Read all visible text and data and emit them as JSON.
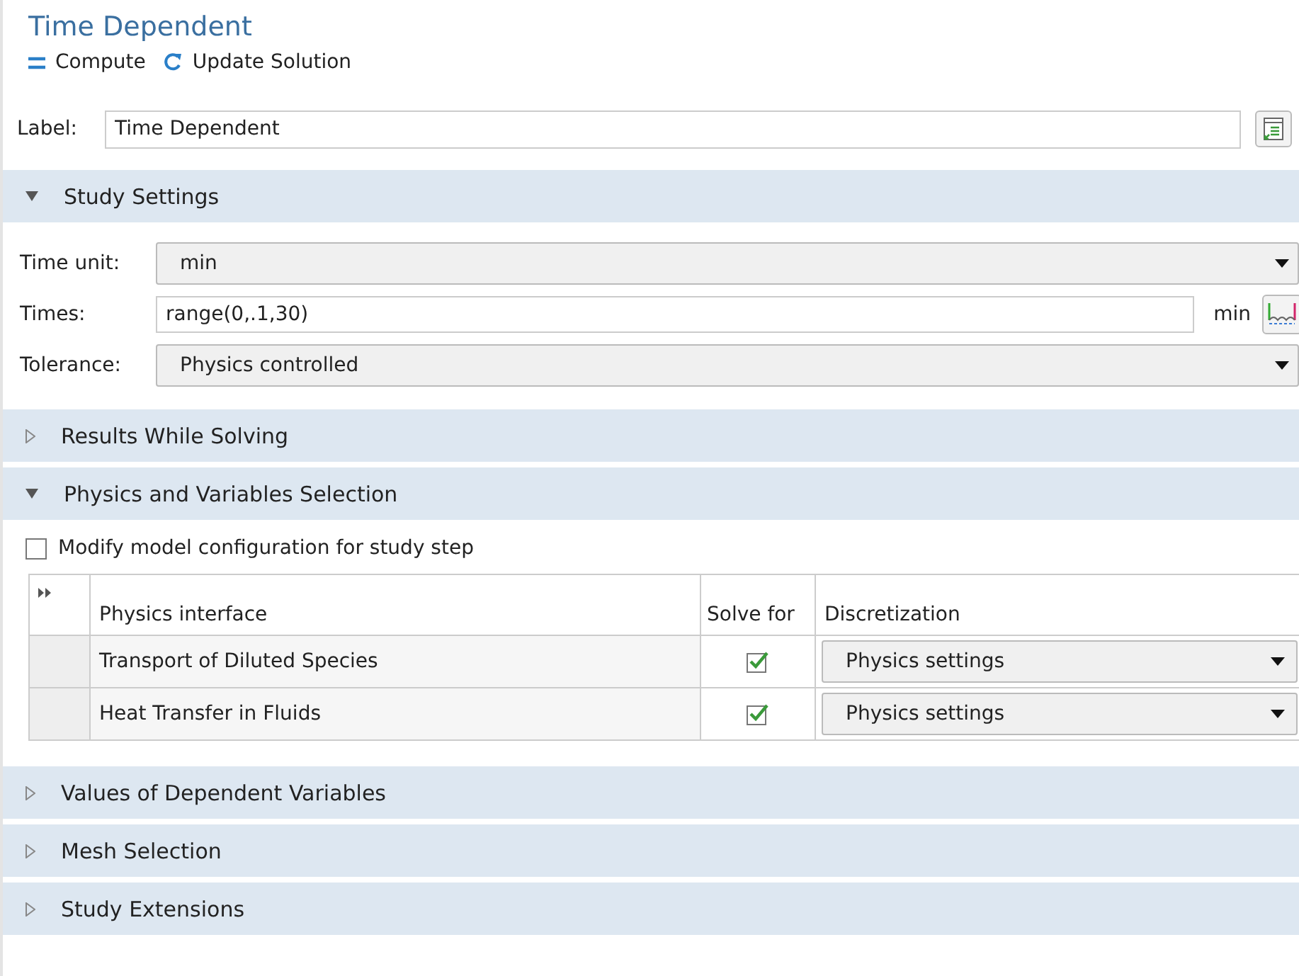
{
  "title": "Time Dependent",
  "toolbar": [
    {
      "kind": "compute",
      "label": "Compute"
    },
    {
      "kind": "update",
      "label": "Update Solution"
    }
  ],
  "label_field": {
    "label": "Label:",
    "value": "Time Dependent"
  },
  "sections": [
    {
      "title": "Study Settings",
      "expanded": true,
      "kind": "study",
      "fields": [
        {
          "kind": "select",
          "label": "Time unit:",
          "value": "min"
        },
        {
          "kind": "text",
          "label": "Times:",
          "value": "range(0,.1,30)",
          "unit": "min"
        },
        {
          "kind": "select",
          "label": "Tolerance:",
          "value": "Physics controlled"
        }
      ]
    },
    {
      "title": "Results While Solving",
      "expanded": false
    },
    {
      "title": "Physics and Variables Selection",
      "expanded": true,
      "kind": "physics",
      "checkbox": {
        "label": "Modify model configuration for study step",
        "checked": false
      },
      "table": {
        "columns": [
          "Physics interface",
          "Solve for",
          "Discretization"
        ],
        "rows": [
          {
            "interface": "Transport of Diluted Species",
            "solve_for": true,
            "discretization": "Physics settings"
          },
          {
            "interface": "Heat Transfer in Fluids",
            "solve_for": true,
            "discretization": "Physics settings"
          }
        ]
      }
    },
    {
      "title": "Values of Dependent Variables",
      "expanded": false
    },
    {
      "title": "Mesh Selection",
      "expanded": false
    },
    {
      "title": "Study Extensions",
      "expanded": false
    }
  ]
}
